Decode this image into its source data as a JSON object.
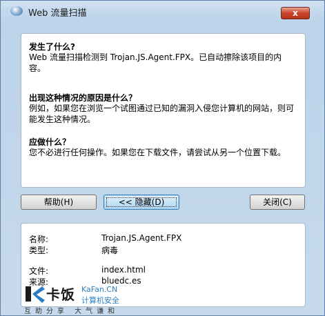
{
  "window": {
    "title": "Web 流量扫描",
    "close_label": "x"
  },
  "top_panel": {
    "what_heading": "发生了什么?",
    "what_body": "Web 流量扫描检测到 Trojan.JS.Agent.FPX。已自动擦除该项目的内容。",
    "why_heading": "出现这种情况的原因是什么？",
    "why_body": "例如，如果您在浏览一个试图通过已知的漏洞入侵您计算机的网站，则可能发生这种情况。",
    "todo_heading": "应做什么？",
    "todo_body": "您不必进行任何操作。如果您在下载文件，请尝试从另一个位置下载。"
  },
  "buttons": {
    "help": "帮助(H)",
    "hide": "<< 隐藏(D)",
    "close": "关闭(C)"
  },
  "details": {
    "name_label": "名称:",
    "name_value": "Trojan.JS.Agent.FPX",
    "type_label": "类型:",
    "type_value": "病毒",
    "file_label": "文件:",
    "file_value": "index.html",
    "source_label": "来源:",
    "source_value": "bluedc.es"
  },
  "watermark": {
    "brand": "卡饭",
    "site": "KaFan.CN",
    "security": "计算机安全",
    "slogan": "互助分享 大气谦和"
  }
}
